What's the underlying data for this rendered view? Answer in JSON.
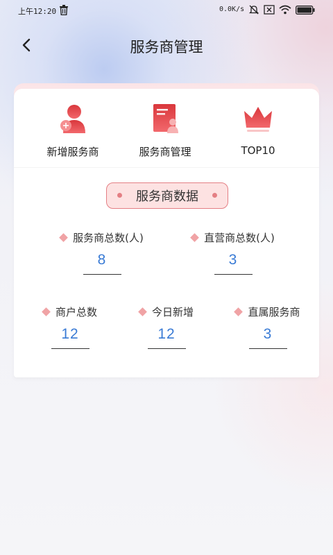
{
  "status_bar": {
    "time": "上午12:20",
    "net_speed": "0.0K/s"
  },
  "header": {
    "title": "服务商管理"
  },
  "menu": [
    {
      "label": "新增服务商",
      "icon": "add-user-icon"
    },
    {
      "label": "服务商管理",
      "icon": "document-user-icon"
    },
    {
      "label": "TOP10",
      "icon": "crown-icon"
    }
  ],
  "section": {
    "title": "服务商数据"
  },
  "stats_row1": [
    {
      "label": "服务商总数(人)",
      "value": "8"
    },
    {
      "label": "直营商总数(人)",
      "value": "3"
    }
  ],
  "stats_row2": [
    {
      "label": "商户总数",
      "value": "12"
    },
    {
      "label": "今日新增",
      "value": "12"
    },
    {
      "label": "直属服务商",
      "value": "3"
    }
  ],
  "colors": {
    "accent_red": "#e24a4f",
    "value_blue": "#3a7bd5",
    "pill_bg": "#fde2e2",
    "diamond": "#f0a3a5"
  }
}
